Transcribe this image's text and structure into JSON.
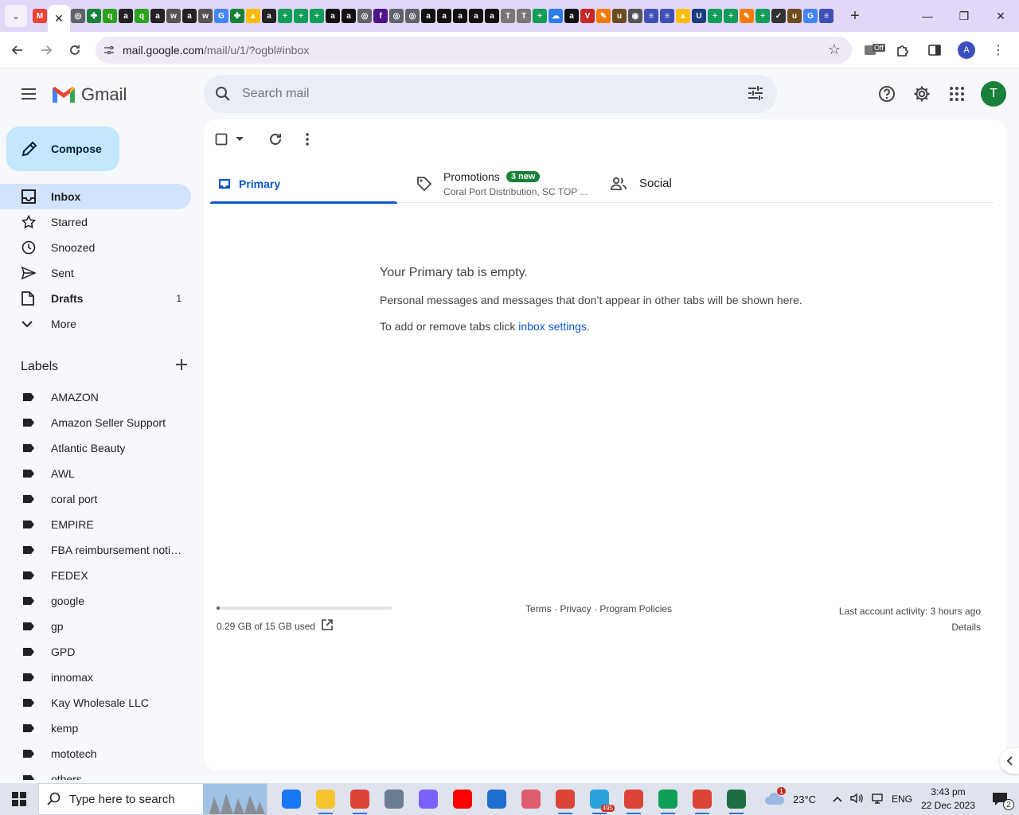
{
  "browser": {
    "tab_icons": [
      {
        "name": "gmail-tab-icon",
        "color": "#ea4335",
        "glyph": "M"
      },
      {
        "name": "wave-tab-icon",
        "color": "#5f6368",
        "glyph": "◎"
      },
      {
        "name": "clover-tab-icon",
        "color": "#188038",
        "glyph": "✤"
      },
      {
        "name": "qb-tab-icon",
        "color": "#2ca01c",
        "glyph": "q"
      },
      {
        "name": "amazon-tab-icon",
        "color": "#222222",
        "glyph": "a"
      },
      {
        "name": "qb-tab-icon",
        "color": "#2ca01c",
        "glyph": "q"
      },
      {
        "name": "amazon-tab-icon",
        "color": "#222222",
        "glyph": "a"
      },
      {
        "name": "wix-tab-icon",
        "color": "#555555",
        "glyph": "w"
      },
      {
        "name": "amazon-tab-icon",
        "color": "#222222",
        "glyph": "a"
      },
      {
        "name": "wix-tab-icon",
        "color": "#555555",
        "glyph": "w"
      },
      {
        "name": "google-tab-icon",
        "color": "#4285f4",
        "glyph": "G"
      },
      {
        "name": "clover-tab-icon",
        "color": "#188038",
        "glyph": "✤"
      },
      {
        "name": "drive-tab-icon",
        "color": "#fbbc04",
        "glyph": "▲"
      },
      {
        "name": "amazon-tab-icon",
        "color": "#222222",
        "glyph": "a"
      },
      {
        "name": "sheets-tab-icon",
        "color": "#0f9d58",
        "glyph": "+"
      },
      {
        "name": "sheets-tab-icon",
        "color": "#0f9d58",
        "glyph": "+"
      },
      {
        "name": "sheets-tab-icon",
        "color": "#0f9d58",
        "glyph": "+"
      },
      {
        "name": "amazon-tab-icon",
        "color": "#111111",
        "glyph": "a"
      },
      {
        "name": "amazon-tab-icon",
        "color": "#111111",
        "glyph": "a"
      },
      {
        "name": "globe-tab-icon",
        "color": "#5f6368",
        "glyph": "◎"
      },
      {
        "name": "fedex-tab-icon",
        "color": "#4d148c",
        "glyph": "f"
      },
      {
        "name": "globe-tab-icon",
        "color": "#5f6368",
        "glyph": "◎"
      },
      {
        "name": "globe-tab-icon",
        "color": "#5f6368",
        "glyph": "◎"
      },
      {
        "name": "amazon-tab-icon",
        "color": "#111111",
        "glyph": "a"
      },
      {
        "name": "amazon-tab-icon",
        "color": "#111111",
        "glyph": "a"
      },
      {
        "name": "amazon-tab-icon",
        "color": "#111111",
        "glyph": "a"
      },
      {
        "name": "amazon-tab-icon",
        "color": "#111111",
        "glyph": "a"
      },
      {
        "name": "amazon-tab-icon",
        "color": "#111111",
        "glyph": "a"
      },
      {
        "name": "t-tab-icon",
        "color": "#777777",
        "glyph": "T"
      },
      {
        "name": "t-tab-icon",
        "color": "#777777",
        "glyph": "T"
      },
      {
        "name": "sheets-tab-icon",
        "color": "#0f9d58",
        "glyph": "+"
      },
      {
        "name": "cloud-tab-icon",
        "color": "#2b7de9",
        "glyph": "☁"
      },
      {
        "name": "amazon-tab-icon",
        "color": "#111111",
        "glyph": "a"
      },
      {
        "name": "vshape-tab-icon",
        "color": "#c62828",
        "glyph": "V"
      },
      {
        "name": "pencil-tab-icon",
        "color": "#f57c00",
        "glyph": "✎"
      },
      {
        "name": "ups-tab-icon",
        "color": "#6d4c1f",
        "glyph": "u"
      },
      {
        "name": "seal-tab-icon",
        "color": "#555555",
        "glyph": "◉"
      },
      {
        "name": "list-tab-icon",
        "color": "#3f51b5",
        "glyph": "≡"
      },
      {
        "name": "list-tab-icon",
        "color": "#3f51b5",
        "glyph": "≡"
      },
      {
        "name": "drive-tab-icon",
        "color": "#fbbc04",
        "glyph": "▲"
      },
      {
        "name": "uline-tab-icon",
        "color": "#1a3d7c",
        "glyph": "U"
      },
      {
        "name": "sheets-tab-icon",
        "color": "#0f9d58",
        "glyph": "+"
      },
      {
        "name": "sheets-tab-icon",
        "color": "#0f9d58",
        "glyph": "+"
      },
      {
        "name": "pencil-tab-icon",
        "color": "#f57c00",
        "glyph": "✎"
      },
      {
        "name": "sheets-tab-icon",
        "color": "#0f9d58",
        "glyph": "+"
      },
      {
        "name": "check-tab-icon",
        "color": "#333333",
        "glyph": "✓"
      },
      {
        "name": "ups-tab-icon",
        "color": "#6d4c1f",
        "glyph": "u"
      },
      {
        "name": "google-tab-icon",
        "color": "#4285f4",
        "glyph": "G"
      },
      {
        "name": "list-tab-icon",
        "color": "#3f51b5",
        "glyph": "≡"
      }
    ],
    "url_host": "mail.google.com",
    "url_path": "/mail/u/1/?ogbl#inbox",
    "extension_badge": "Off",
    "profile_letter": "A"
  },
  "gmail": {
    "brand": "Gmail",
    "search_placeholder": "Search mail",
    "avatar_letter": "T",
    "compose_label": "Compose",
    "nav": [
      {
        "label": "Inbox",
        "icon": "inbox-icon",
        "count": "",
        "active": true,
        "bold": true
      },
      {
        "label": "Starred",
        "icon": "star-icon",
        "count": "",
        "active": false,
        "bold": false
      },
      {
        "label": "Snoozed",
        "icon": "clock-icon",
        "count": "",
        "active": false,
        "bold": false
      },
      {
        "label": "Sent",
        "icon": "send-icon",
        "count": "",
        "active": false,
        "bold": false
      },
      {
        "label": "Drafts",
        "icon": "draft-icon",
        "count": "1",
        "active": false,
        "bold": true
      },
      {
        "label": "More",
        "icon": "chevron-down-icon",
        "count": "",
        "active": false,
        "bold": false
      }
    ],
    "labels_title": "Labels",
    "labels": [
      "AMAZON",
      "Amazon Seller Support",
      "Atlantic Beauty",
      "AWL",
      "coral port",
      "EMPIRE",
      "FBA reimbursement notifications",
      "FEDEX",
      "google",
      "gp",
      "GPD",
      "innomax",
      "Kay Wholesale LLC",
      "kemp",
      "mototech",
      "others"
    ],
    "tabs": {
      "primary": "Primary",
      "promotions": "Promotions",
      "promotions_badge": "3 new",
      "promotions_snippet": "Coral Port Distribution, SC TOP ...",
      "social": "Social"
    },
    "empty": {
      "title": "Your Primary tab is empty.",
      "desc": "Personal messages and messages that don’t appear in other tabs will be shown here.",
      "hint_prefix": "To add or remove tabs click ",
      "hint_link": "inbox settings",
      "hint_suffix": "."
    },
    "footer": {
      "storage": "0.29 GB of 15 GB used",
      "storage_fraction": 0.019,
      "policies": "Terms · Privacy · Program Policies",
      "activity": "Last account activity: 3 hours ago",
      "details": "Details"
    }
  },
  "taskbar": {
    "search_placeholder": "Type here to search",
    "apps": [
      {
        "name": "facebook-app-icon",
        "color": "#1877f2",
        "running": false
      },
      {
        "name": "file-explorer-icon",
        "color": "#f4c430",
        "running": true
      },
      {
        "name": "chrome-app-icon",
        "color": "#db4437",
        "running": true
      },
      {
        "name": "calculator-icon",
        "color": "#6b7c93",
        "running": false
      },
      {
        "name": "copilot-icon",
        "color": "#7b61ff",
        "running": false
      },
      {
        "name": "youtube-icon",
        "color": "#ff0000",
        "running": false
      },
      {
        "name": "store-icon",
        "color": "#1f6fd1",
        "running": false
      },
      {
        "name": "snipping-tool-icon",
        "color": "#e05d6f",
        "running": false
      },
      {
        "name": "chrome-profile-icon",
        "color": "#db4437",
        "running": true
      },
      {
        "name": "telegram-icon",
        "color": "#2aa1da",
        "running": true
      },
      {
        "name": "chrome-profile-a-icon",
        "color": "#db4437",
        "running": true
      },
      {
        "name": "chrome-profile-a2-icon",
        "color": "#0f9d58",
        "running": true
      },
      {
        "name": "chrome-profile-c-icon",
        "color": "#db4437",
        "running": true
      },
      {
        "name": "excel-icon",
        "color": "#1d6f42",
        "running": true
      }
    ],
    "telegram_badge": "495",
    "weather_temp": "23°C",
    "weather_alert": "1",
    "language": "ENG",
    "time": "3:43 pm",
    "date": "22 Dec 2023",
    "notifications": "2"
  }
}
